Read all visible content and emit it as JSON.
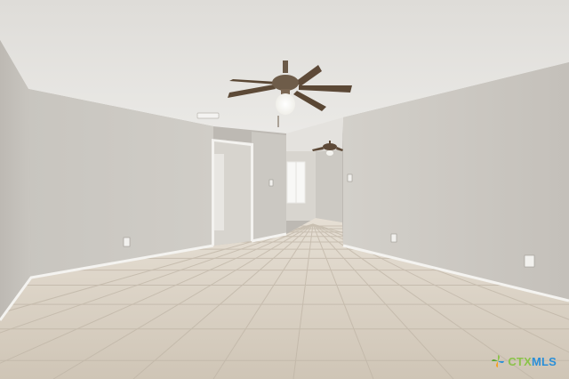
{
  "watermark": {
    "brand_prefix": "CTX",
    "brand_suffix": "MLS",
    "icon": "leaf-pinwheel-icon",
    "colors": {
      "prefix": "#8bc34a",
      "suffix": "#2a8fd8"
    }
  }
}
